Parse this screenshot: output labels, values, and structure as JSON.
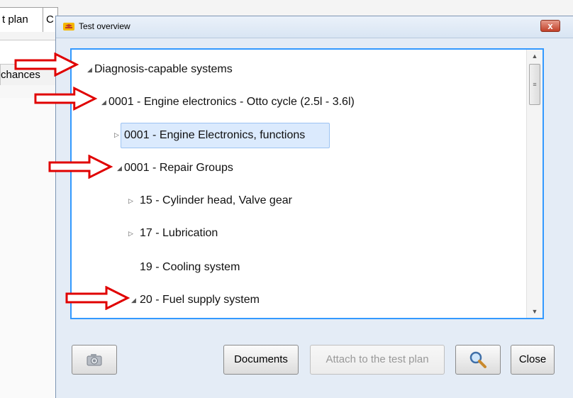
{
  "background": {
    "tab_1": "t plan",
    "tab_2": "C",
    "row_label": "chances"
  },
  "dialog": {
    "title": "Test overview",
    "close_glyph": "x",
    "tree": [
      {
        "label": "Diagnosis-capable systems",
        "toggle": "◢",
        "expanded": true
      },
      {
        "label": "0001 - Engine electronics - Otto cycle (2.5l - 3.6l)",
        "toggle": "◢",
        "expanded": true
      },
      {
        "label": "0001 - Engine Electronics, functions",
        "toggle": "▷",
        "expanded": false,
        "selected": true
      },
      {
        "label": "0001 - Repair Groups",
        "toggle": "◢",
        "expanded": true
      },
      {
        "label": "15 - Cylinder head, Valve gear",
        "toggle": "▷",
        "expanded": false
      },
      {
        "label": "17 - Lubrication",
        "toggle": "▷",
        "expanded": false
      },
      {
        "label": "19 - Cooling system",
        "toggle": "",
        "expanded": false
      },
      {
        "label": "20 - Fuel supply system",
        "toggle": "◢",
        "expanded": true
      }
    ],
    "scroll_up": "▲",
    "scroll_down": "▼",
    "scroll_thumb_grip": "≡",
    "buttons": {
      "documents": "Documents",
      "attach": "Attach to the test plan",
      "close": "Close"
    },
    "icons": [
      "camera-icon",
      "magnifier-icon"
    ]
  },
  "colors": {
    "annotation_arrow": "#e00000",
    "selection": "#dbeafd",
    "panel_border": "#3399ff"
  }
}
